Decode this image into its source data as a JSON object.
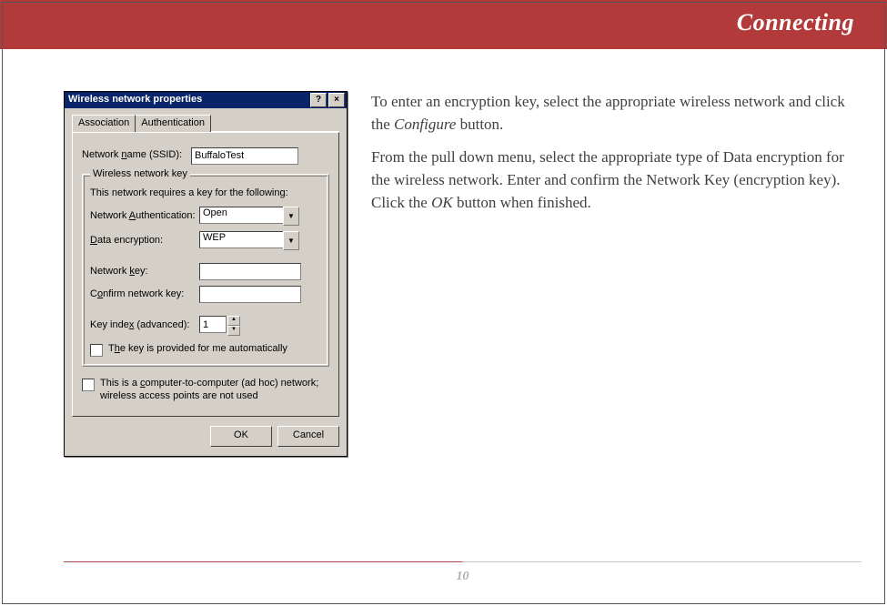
{
  "banner": {
    "title": "Connecting"
  },
  "dialog": {
    "title": "Wireless network properties",
    "help_btn": "?",
    "close_btn": "×",
    "tabs": {
      "assoc": "Association",
      "auth": "Authentication"
    },
    "ssid_label_pre": "Network ",
    "ssid_label_und": "n",
    "ssid_label_post": "ame (SSID):",
    "ssid_value": "BuffaloTest",
    "group_legend": "Wireless network key",
    "requires_text": "This network requires a key for the following:",
    "auth_label_pre": "Network ",
    "auth_label_und": "A",
    "auth_label_post": "uthentication:",
    "auth_value": "Open",
    "enc_label_und": "D",
    "enc_label_post": "ata encryption:",
    "enc_value": "WEP",
    "key_label_pre": "Network ",
    "key_label_und": "k",
    "key_label_post": "ey:",
    "confirm_label_pre": "C",
    "confirm_label_und": "o",
    "confirm_label_post": "nfirm network key:",
    "index_label_pre": "Key inde",
    "index_label_und": "x",
    "index_label_post": " (advanced):",
    "index_value": "1",
    "auto_label_pre": "T",
    "auto_label_und": "h",
    "auto_label_post": "e key is provided for me automatically",
    "adhoc_label_pre": "This is a ",
    "adhoc_label_und": "c",
    "adhoc_label_post": "omputer-to-computer (ad hoc) network; wireless access points are not used",
    "ok": "OK",
    "cancel": "Cancel"
  },
  "instructions": {
    "p1a": "To enter an encryption key, select the appropriate wireless network and click the ",
    "p1b": "Configure",
    "p1c": " button.",
    "p2a": "From the pull down menu, select the appropriate type of  Data encryption for the wireless network.  Enter and confirm the Network Key (encryption key).  Click the ",
    "p2b": "OK",
    "p2c": " button when finished."
  },
  "footer": {
    "page": "10"
  }
}
